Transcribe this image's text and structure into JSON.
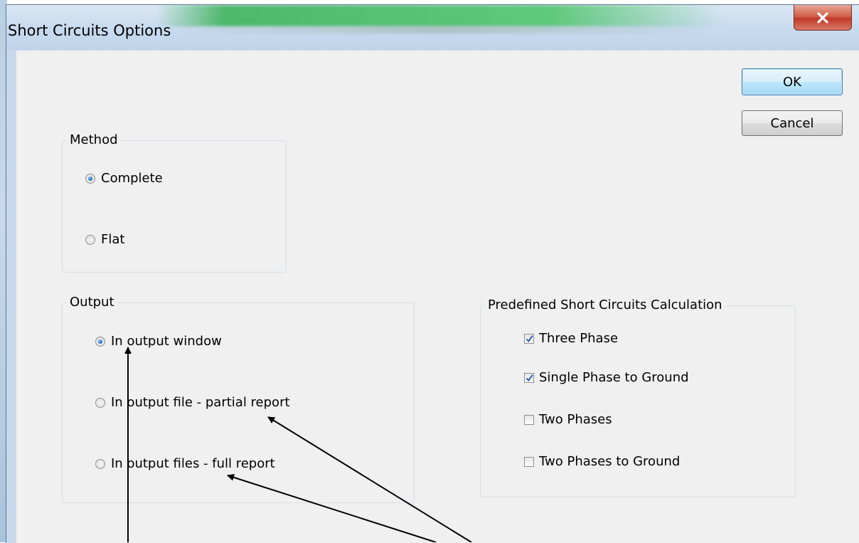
{
  "window": {
    "title": "Short Circuits Options",
    "close_icon": "close-icon"
  },
  "buttons": {
    "ok_label": "OK",
    "cancel_label": "Cancel"
  },
  "method": {
    "label": "Method",
    "options": [
      {
        "label": "Complete",
        "checked": true
      },
      {
        "label": "Flat",
        "checked": false
      }
    ]
  },
  "output": {
    "label": "Output",
    "options": [
      {
        "label": "In output window",
        "checked": true
      },
      {
        "label": "In output file - partial report",
        "checked": false
      },
      {
        "label": "In output files - full report",
        "checked": false
      }
    ]
  },
  "predefined": {
    "label": "Predefined Short Circuits Calculation",
    "options": [
      {
        "label": "Three Phase",
        "checked": true
      },
      {
        "label": "Single Phase to Ground",
        "checked": true
      },
      {
        "label": "Two Phases",
        "checked": false
      },
      {
        "label": "Two Phases to Ground",
        "checked": false
      }
    ]
  },
  "colors": {
    "accent": "#3c7fb1",
    "close_button": "#c0392b",
    "dialog_background": "#f0f0f0"
  }
}
